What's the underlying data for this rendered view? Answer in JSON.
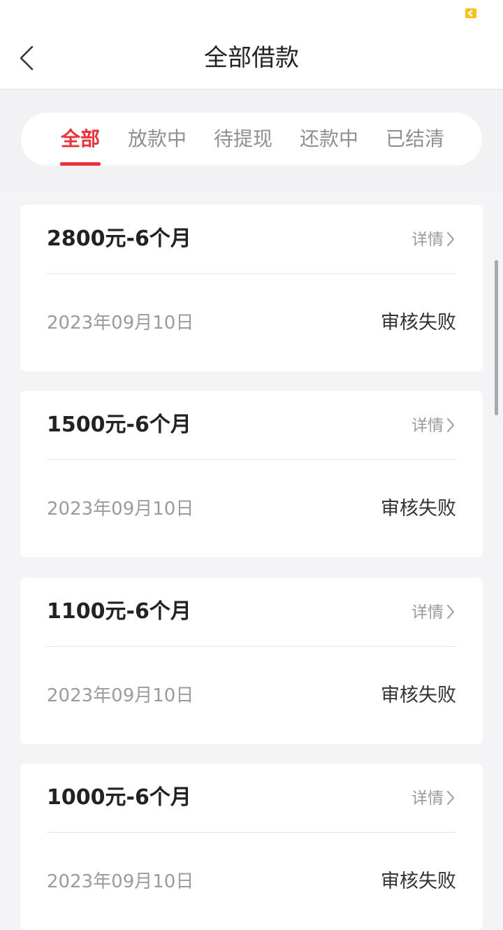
{
  "header": {
    "title": "全部借款"
  },
  "tabs": [
    {
      "label": "全部",
      "active": true
    },
    {
      "label": "放款中",
      "active": false
    },
    {
      "label": "待提现",
      "active": false
    },
    {
      "label": "还款中",
      "active": false
    },
    {
      "label": "已结清",
      "active": false
    }
  ],
  "loans": [
    {
      "title": "2800元-6个月",
      "detail_label": "详情",
      "date": "2023年09月10日",
      "status": "审核失败"
    },
    {
      "title": "1500元-6个月",
      "detail_label": "详情",
      "date": "2023年09月10日",
      "status": "审核失败"
    },
    {
      "title": "1100元-6个月",
      "detail_label": "详情",
      "date": "2023年09月10日",
      "status": "审核失败"
    },
    {
      "title": "1000元-6个月",
      "detail_label": "详情",
      "date": "2023年09月10日",
      "status": "审核失败"
    }
  ],
  "colors": {
    "accent": "#e8333a",
    "status_icon": "#f6c21a"
  },
  "icons": {
    "back": "chevron-left-icon",
    "detail": "chevron-right-icon",
    "status": "app-status-icon"
  }
}
